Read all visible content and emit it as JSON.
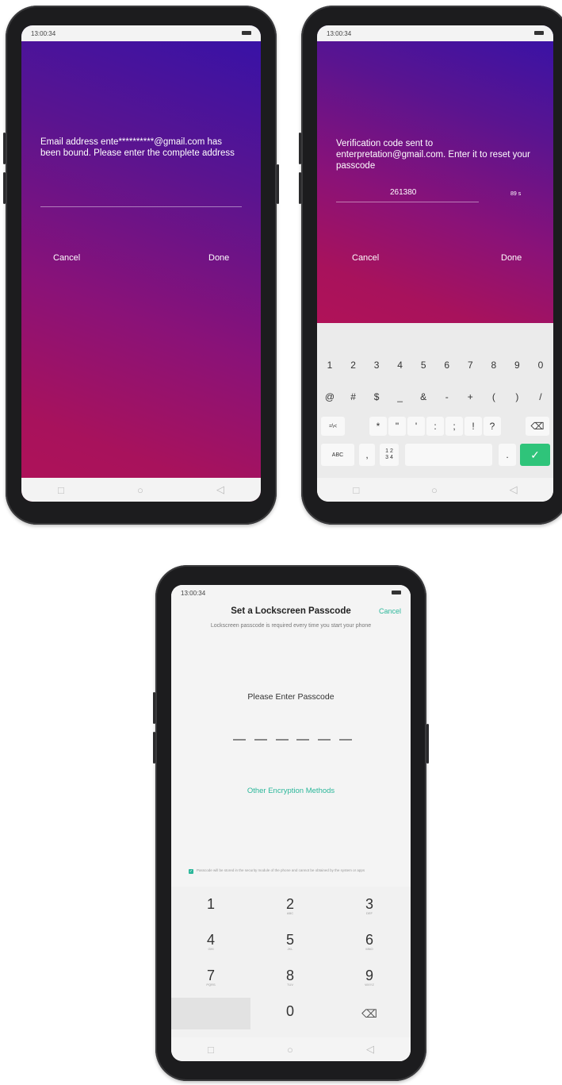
{
  "colors": {
    "accent": "#2bb79a",
    "done_key": "#2fc47a"
  },
  "phone1": {
    "status_time": "13:00:34",
    "message": "Email address ente**********@gmail.com has been bound. Please enter the complete address",
    "cancel": "Cancel",
    "done": "Done"
  },
  "phone2": {
    "status_time": "13:00:34",
    "message": "Verification code sent to enterpretation@gmail.com. Enter it to reset your passcode",
    "code": "261380",
    "countdown": "89 s",
    "cancel": "Cancel",
    "done": "Done",
    "keyboard": {
      "row1": [
        "1",
        "2",
        "3",
        "4",
        "5",
        "6",
        "7",
        "8",
        "9",
        "0"
      ],
      "row2": [
        "@",
        "#",
        "$",
        "_",
        "&",
        "-",
        "+",
        "(",
        ")",
        "/"
      ],
      "row3_toggle": "=\\<",
      "row3": [
        "*",
        "\"",
        "'",
        ":",
        ";",
        "!",
        "?"
      ],
      "abc": "ABC",
      "comma": ",",
      "num_toggle_top": "1 2",
      "num_toggle_bottom": "3 4",
      "period": "."
    }
  },
  "phone3": {
    "status_time": "13:00:34",
    "title": "Set a Lockscreen Passcode",
    "cancel": "Cancel",
    "subtitle": "Lockscreen passcode is required every time you start your phone",
    "prompt": "Please Enter Passcode",
    "other_methods": "Other Encryption Methods",
    "checkbox_text": "Passcode will be stored in the security module of the phone and cannot be obtained by the system or apps",
    "checkbox_checked": true,
    "keys": [
      {
        "digit": "1",
        "letters": ""
      },
      {
        "digit": "2",
        "letters": "ABC"
      },
      {
        "digit": "3",
        "letters": "DEF"
      },
      {
        "digit": "4",
        "letters": "GHI"
      },
      {
        "digit": "5",
        "letters": "JKL"
      },
      {
        "digit": "6",
        "letters": "MNO"
      },
      {
        "digit": "7",
        "letters": "PQRS"
      },
      {
        "digit": "8",
        "letters": "TUV"
      },
      {
        "digit": "9",
        "letters": "WXYZ"
      },
      {
        "digit": "0",
        "letters": ""
      }
    ]
  }
}
